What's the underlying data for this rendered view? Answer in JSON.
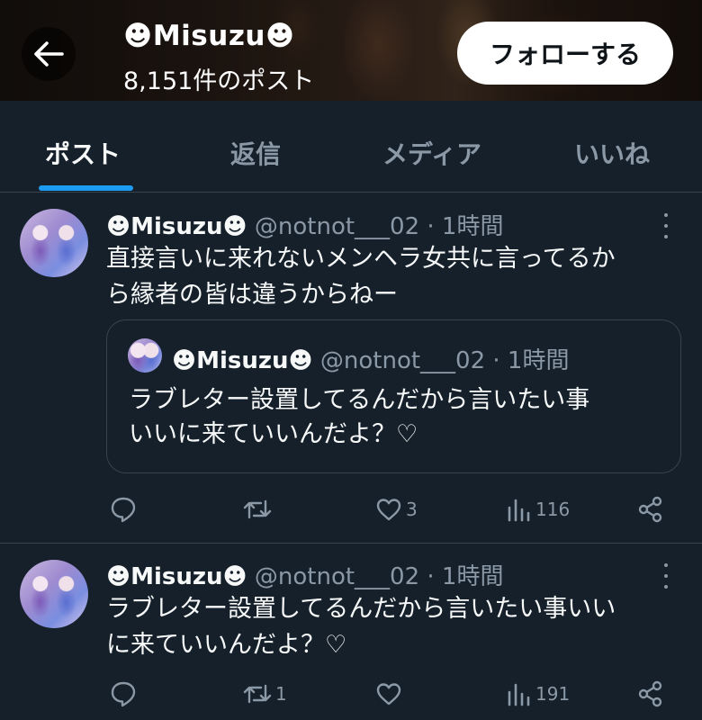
{
  "header": {
    "title": "☻Misuzu☻",
    "post_count": "8,151件のポスト",
    "follow_label": "フォローする",
    "back_icon": "arrow-left-icon"
  },
  "tabs": [
    {
      "label": "ポスト",
      "active": true
    },
    {
      "label": "返信",
      "active": false
    },
    {
      "label": "メディア",
      "active": false
    },
    {
      "label": "いいね",
      "active": false
    }
  ],
  "posts": [
    {
      "name": "☻Misuzu☻",
      "handle_time": "@notnot___02 · 1時間",
      "text_line1": "直接言いに来れないメンヘラ女共に言ってるか",
      "text_line2": "ら縁者の皆は違うからねー",
      "quote": {
        "name": "☻Misuzu☻",
        "handle_time": "@notnot___02 · 1時間",
        "text_line1": "ラブレター設置してるんだから言いたい事",
        "text_line2": "いいに来ていいんだよ？♡"
      },
      "actions": {
        "reply": "",
        "repost": "",
        "like": "3",
        "views": "116"
      }
    },
    {
      "name": "☻Misuzu☻",
      "handle_time": "@notnot___02 · 1時間",
      "text_line1": "ラブレター設置してるんだから言いたい事いい",
      "text_line2": "に来ていいんだよ？♡",
      "actions": {
        "reply": "",
        "repost": "1",
        "like": "",
        "views": "191"
      }
    }
  ],
  "colors": {
    "background": "#15202b",
    "accent": "#1d9bf0",
    "muted": "#8b98a5",
    "border": "#38444d"
  }
}
